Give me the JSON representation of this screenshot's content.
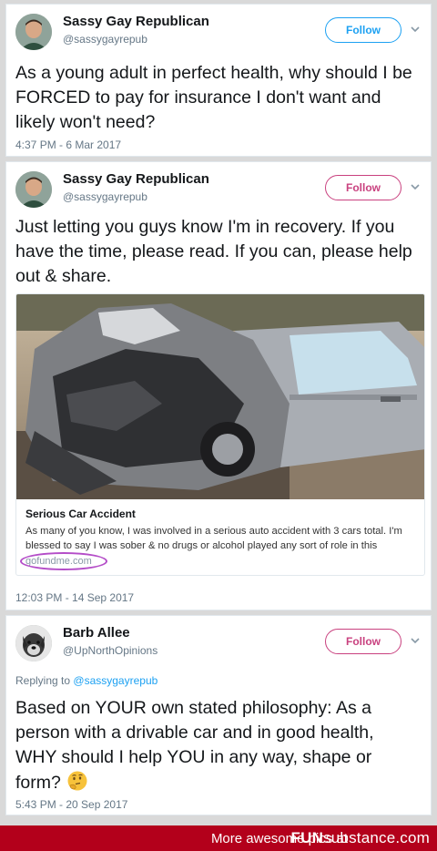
{
  "tweets": [
    {
      "user_name": "Sassy Gay Republican",
      "handle": "@sassygayrepub",
      "follow_label": "Follow",
      "text": "As a young adult in perfect health, why should I be FORCED to pay for insurance I don't want and likely won't need?",
      "timestamp": "4:37 PM - 6 Mar 2017"
    },
    {
      "user_name": "Sassy Gay Republican",
      "handle": "@sassygayrepub",
      "follow_label": "Follow",
      "text": "Just letting you guys know I'm in recovery. If you have the time, please read. If you can, please help out & share.",
      "card": {
        "title": "Serious Car Accident",
        "description": "As many of you know, I was involved in a serious auto accident with 3 cars total. I'm blessed to say I was sober & no drugs or alcohol played any sort of role in this",
        "domain": "gofundme.com"
      },
      "timestamp": "12:03 PM - 14 Sep 2017"
    },
    {
      "user_name": "Barb Allee",
      "handle": "@UpNorthOpinions",
      "follow_label": "Follow",
      "replying_prefix": "Replying to",
      "replying_handle": "@sassygayrepub",
      "text": "Based on YOUR own stated philosophy: As a person with a drivable car and in good health, WHY should I help YOU in any way, shape or form?",
      "emoji": "thinking-face",
      "timestamp": "5:43 PM - 20 Sep 2017"
    }
  ],
  "footer": {
    "text": "More awesome pics at",
    "logo_fun": "FUN",
    "logo_substance": "substance",
    "logo_tld": ".com"
  },
  "colors": {
    "follow_blue": "#1da1f2",
    "follow_pink": "#c9417f",
    "footer_bg": "#b3001b",
    "annotation_circle": "#b44dc8"
  }
}
